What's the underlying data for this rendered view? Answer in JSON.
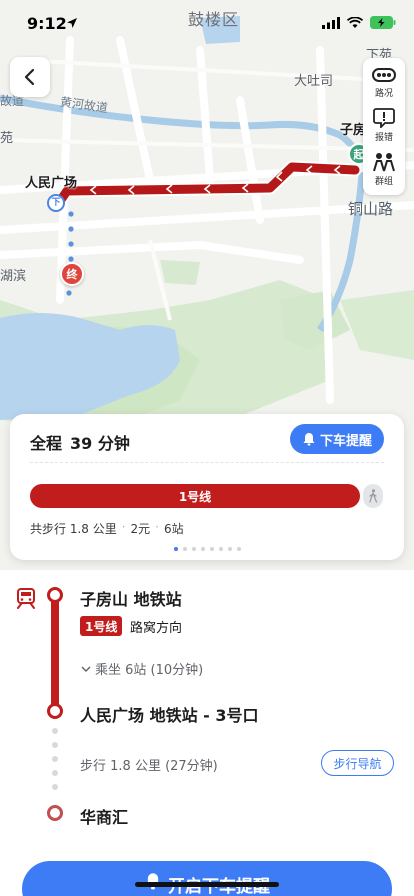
{
  "status_bar": {
    "time": "9:12"
  },
  "map": {
    "district_label": "鼓楼区",
    "place_labels": {
      "xiafang": "下苑",
      "dajixiang": "大吐司",
      "yuan": "苑",
      "hubin": "湖滨",
      "gudao_left": "故道"
    },
    "road_labels": {
      "huanggu": "黄河故道",
      "tongshan": "铜山路"
    },
    "stations": {
      "origin_name": "子房",
      "origin_marker": "起",
      "dest_marker": "终",
      "exit_marker": "下",
      "renmin": "人民广场"
    },
    "tools": [
      {
        "label": "路况",
        "icon": "traffic-icon"
      },
      {
        "label": "报错",
        "icon": "report-error-icon"
      },
      {
        "label": "群组",
        "icon": "group-icon"
      }
    ]
  },
  "summary": {
    "prefix": "全程",
    "duration": "39 分钟",
    "alert_button": "下车提醒",
    "line_name": "1号线",
    "stats": {
      "walk": "共步行 1.8 公里",
      "price": "2元",
      "stops": "6站"
    },
    "pages_total": 8,
    "page_index": 0
  },
  "detail": {
    "origin_station": "子房山 地铁站",
    "line_badge": "1号线",
    "direction": "路窝方向",
    "ride_info": "乘坐 6站 (10分钟)",
    "transfer_station": "人民广场 地铁站 - 3号口",
    "walk_info": "步行 1.8 公里 (27分钟)",
    "walk_nav_button": "步行导航",
    "destination": "华商汇"
  },
  "bottom_button": {
    "label": "开启下车提醒"
  },
  "colors": {
    "accent_blue": "#3d7cf5",
    "metro_red": "#c21d1d"
  }
}
